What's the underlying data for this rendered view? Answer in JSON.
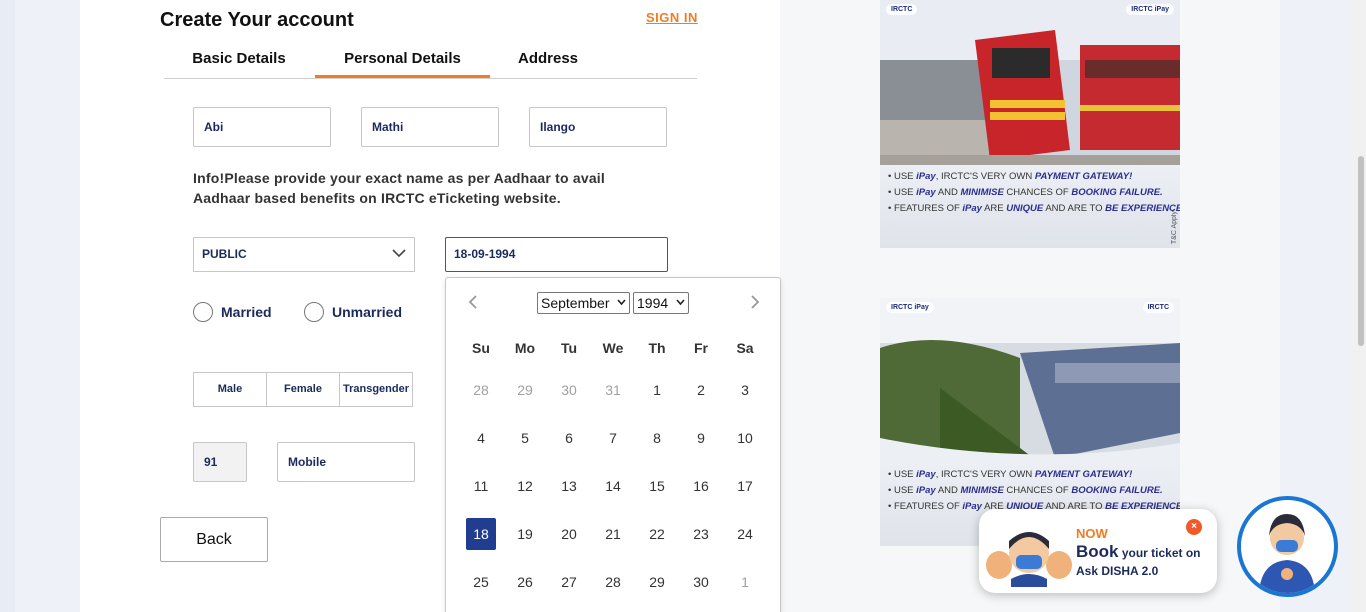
{
  "header": {
    "title": "Create Your account",
    "signin": "SIGN IN"
  },
  "tabs": [
    {
      "label": "Basic Details"
    },
    {
      "label": "Personal Details",
      "active": true
    },
    {
      "label": "Address"
    }
  ],
  "form": {
    "first_name": "Abi",
    "middle_name": "Mathi",
    "last_name": "Ilango",
    "info": "Info!Please provide your exact name as per Aadhaar to avail Aadhaar based benefits on IRCTC eTicketing website.",
    "occupation": "PUBLIC",
    "dob": "18-09-1994",
    "marital": [
      "Married",
      "Unmarried"
    ],
    "gender": [
      "Male",
      "Female",
      "Transgender"
    ],
    "country_code": "91",
    "mobile_placeholder": "Mobile",
    "back": "Back"
  },
  "calendar": {
    "month": "September",
    "year": "1994",
    "weekdays": [
      "Su",
      "Mo",
      "Tu",
      "We",
      "Th",
      "Fr",
      "Sa"
    ],
    "rows": [
      [
        "28",
        "29",
        "30",
        "31",
        "1",
        "2",
        "3"
      ],
      [
        "4",
        "5",
        "6",
        "7",
        "8",
        "9",
        "10"
      ],
      [
        "11",
        "12",
        "13",
        "14",
        "15",
        "16",
        "17"
      ],
      [
        "18",
        "19",
        "20",
        "21",
        "22",
        "23",
        "24"
      ],
      [
        "25",
        "26",
        "27",
        "28",
        "29",
        "30",
        "1"
      ]
    ],
    "selected": "18"
  },
  "ads": [
    {
      "logo_left": "IRCTC",
      "logo_right": "IRCTC iPay",
      "lines": [
        [
          "USE ",
          "iPay",
          ", IRCTC'S VERY OWN ",
          "PAYMENT GATEWAY!"
        ],
        [
          "USE ",
          "iPay",
          " AND ",
          "MINIMISE",
          " CHANCES OF ",
          "BOOKING FAILURE."
        ],
        [
          "FEATURES OF ",
          "iPay",
          " ARE ",
          "UNIQUE",
          " AND ARE TO ",
          "BE EXPERIENCED!"
        ]
      ],
      "tc": "T&C Apply"
    },
    {
      "logo_left": "IRCTC iPay",
      "logo_right": "IRCTC",
      "lines": [
        [
          "USE ",
          "iPay",
          ", IRCTC'S VERY OWN ",
          "PAYMENT GATEWAY!"
        ],
        [
          "USE ",
          "iPay",
          " AND ",
          "MINIMISE",
          " CHANCES OF ",
          "BOOKING FAILURE."
        ],
        [
          "FEATURES OF ",
          "iPay",
          " ARE ",
          "UNIQUE",
          " AND ARE TO ",
          "BE EXPERIENCED!"
        ]
      ]
    }
  ],
  "disha": {
    "now": "NOW",
    "book": "Book",
    "book_rest": " your ticket on",
    "ask": "Ask DISHA 2.0",
    "close": "×"
  },
  "colors": {
    "accent": "#f47b20",
    "navy": "#213d8f",
    "text_navy": "#1b2a5c"
  }
}
